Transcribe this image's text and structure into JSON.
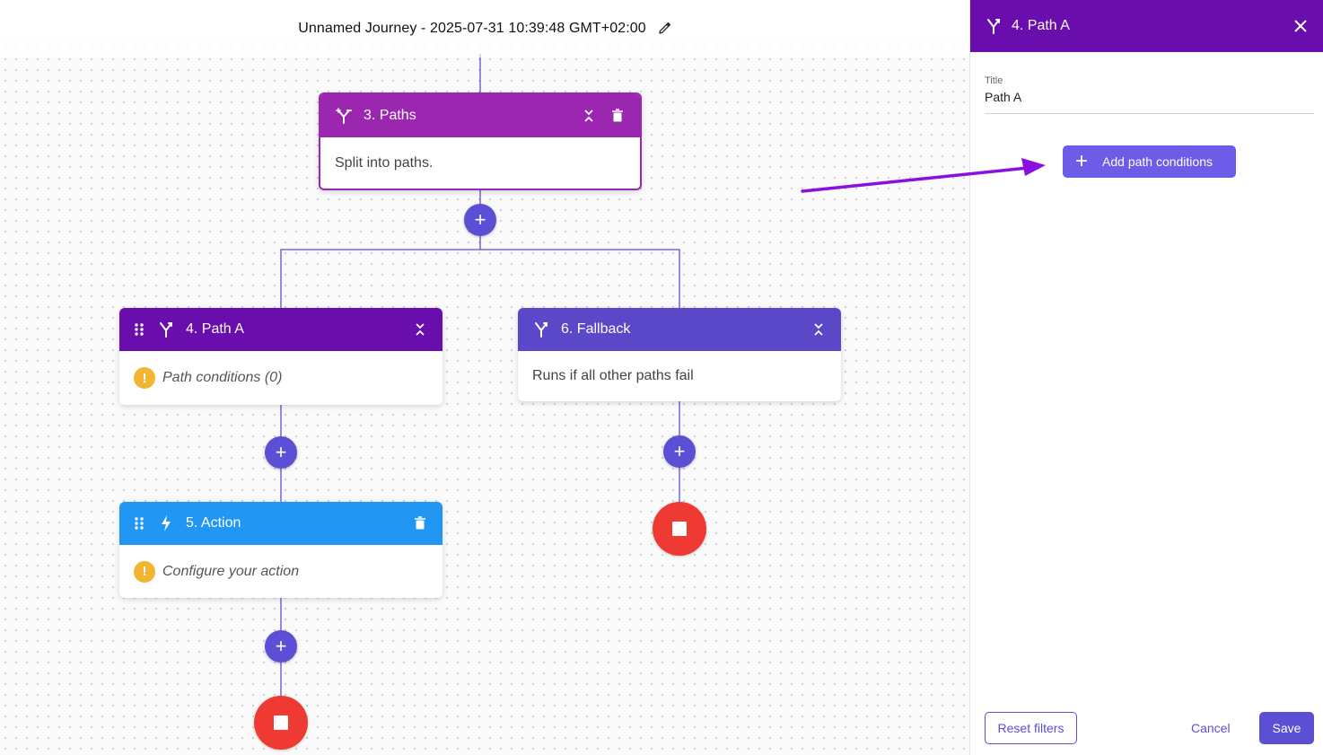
{
  "header": {
    "journey_title": "Unnamed Journey - 2025-07-31 10:39:48 GMT+02:00"
  },
  "nodes": {
    "paths": {
      "title": "3. Paths",
      "body": "Split into paths.",
      "color": "#9b27b0"
    },
    "path_a": {
      "title": "4. Path A",
      "body": "Path conditions (0)",
      "color": "#6a0dad"
    },
    "fallback": {
      "title": "6. Fallback",
      "body": "Runs if all other paths fail",
      "color": "#5a48c8"
    },
    "action": {
      "title": "5. Action",
      "body": "Configure your action",
      "color": "#2196f3"
    }
  },
  "panel": {
    "title": "4. Path A",
    "field_label": "Title",
    "field_value": "Path A",
    "add_button": "Add path conditions",
    "reset_button": "Reset filters",
    "cancel_button": "Cancel",
    "save_button": "Save",
    "header_color": "#6a0dad",
    "accent_color": "#5b4fd6"
  },
  "icons": {
    "split": "split-icon",
    "merge": "merge-icon",
    "bolt": "bolt-icon",
    "grip": "drag-handle-icon",
    "collapse": "collapse-icon",
    "trash": "trash-icon",
    "pencil": "pencil-icon",
    "close": "close-icon",
    "warning": "warning-icon",
    "stop": "stop-icon"
  }
}
